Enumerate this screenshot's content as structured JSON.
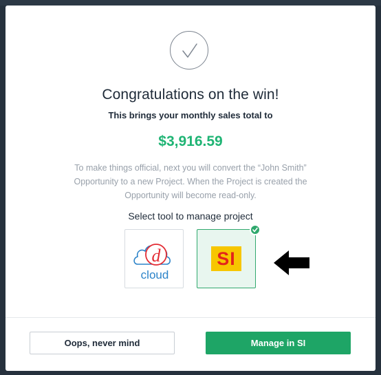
{
  "modal": {
    "title": "Congratulations on the win!",
    "subtitle": "This brings your monthly sales total to",
    "amount": "$3,916.59",
    "description": "To make things official, next you will convert the “John Smith” Opportunity to a new Project. When the Project is created the Opportunity will become read-only.",
    "select_label": "Select tool to manage project",
    "tools": [
      {
        "name": "dcloud",
        "logo_letter": "d",
        "logo_word": "cloud",
        "selected": false
      },
      {
        "name": "SI",
        "logo_text": "SI",
        "selected": true
      }
    ],
    "cancel_label": "Oops, never mind",
    "confirm_label": "Manage in SI"
  },
  "colors": {
    "accent": "#1ea566",
    "amount": "#1fb474",
    "backdrop": "#26313d",
    "si_logo_bg": "#f7c600",
    "si_logo_text": "#e3241b",
    "dcloud_red": "#e32b33",
    "dcloud_blue": "#2b83c9"
  },
  "icons": {
    "success": "checkmark-circle-icon",
    "selected": "check-badge-icon",
    "pointer": "left-arrow-icon"
  }
}
